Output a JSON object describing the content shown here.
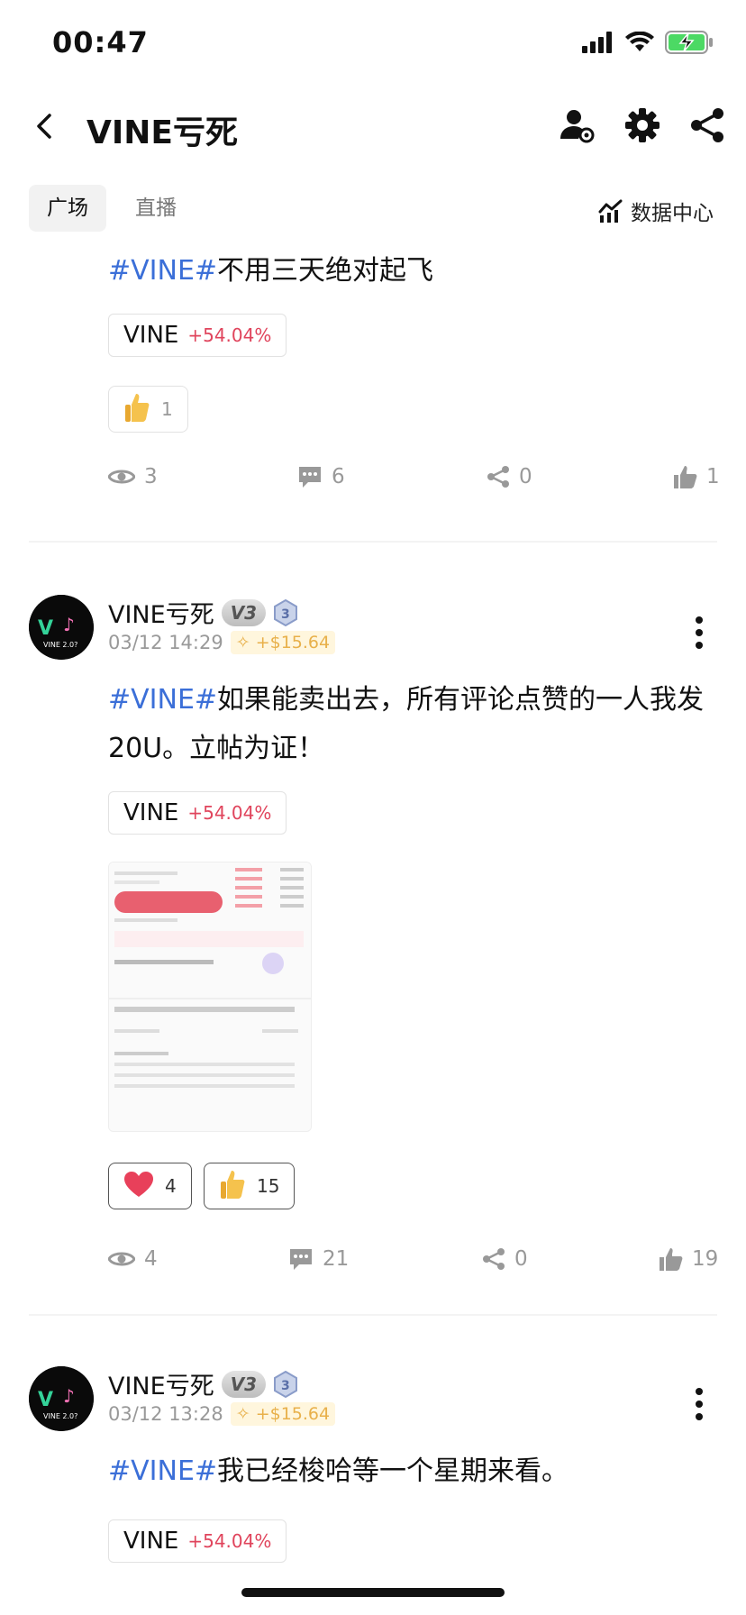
{
  "status_bar": {
    "time": "00:47"
  },
  "header": {
    "title": "VINE亏死"
  },
  "tabs": [
    {
      "label": "广场"
    },
    {
      "label": "直播"
    }
  ],
  "data_center": {
    "label": "数据中心"
  },
  "colors": {
    "hashtag": "#3b6fd8",
    "positive": "#e0445c",
    "muted": "#999999"
  },
  "posts": [
    {
      "hashtag": "#VINE#",
      "text": "不用三天绝对起飞",
      "coin": {
        "name": "VINE",
        "change": "+54.04%"
      },
      "reactions": [
        {
          "icon": "thumbs-up-emoji-icon",
          "count": "1"
        }
      ],
      "stats": {
        "views": "3",
        "comments": "6",
        "shares": "0",
        "likes": "1"
      }
    },
    {
      "author": "VINE亏死",
      "badge_v": "V3",
      "badge_level": "3",
      "time": "03/12 14:29",
      "profit": "+$15.64",
      "hashtag": "#VINE#",
      "text": "如果能卖出去，所有评论点赞的一人我发20U。立帖为证！",
      "coin": {
        "name": "VINE",
        "change": "+54.04%"
      },
      "reactions": [
        {
          "icon": "heart-emoji-icon",
          "count": "4"
        },
        {
          "icon": "thumbs-up-emoji-icon",
          "count": "15"
        }
      ],
      "stats": {
        "views": "4",
        "comments": "21",
        "shares": "0",
        "likes": "19"
      }
    },
    {
      "author": "VINE亏死",
      "badge_v": "V3",
      "badge_level": "3",
      "time": "03/12 13:28",
      "profit": "+$15.64",
      "hashtag": "#VINE#",
      "text": "我已经梭哈等一个星期来看。",
      "coin": {
        "name": "VINE",
        "change": "+54.04%"
      }
    }
  ]
}
